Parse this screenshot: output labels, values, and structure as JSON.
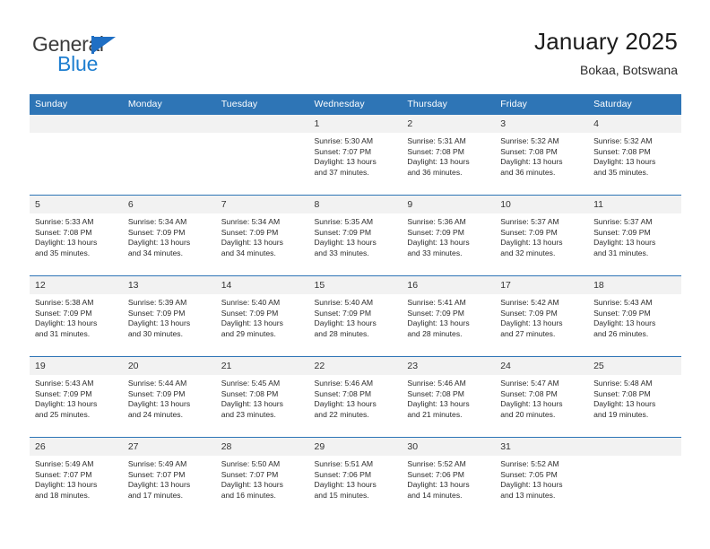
{
  "brand": {
    "name_part1": "General",
    "name_part2": "Blue",
    "flag_icon": "flag-triangle-icon",
    "accent_color": "#1f7fd0"
  },
  "header": {
    "title": "January 2025",
    "subtitle": "Bokaa, Botswana",
    "header_bg": "#2e75b6",
    "daynum_bg": "#f2f2f2"
  },
  "weekdays": [
    "Sunday",
    "Monday",
    "Tuesday",
    "Wednesday",
    "Thursday",
    "Friday",
    "Saturday"
  ],
  "weeks": [
    [
      {
        "day": "",
        "blank": true,
        "sunrise": "",
        "sunset": "",
        "daylight1": "",
        "daylight2": ""
      },
      {
        "day": "",
        "blank": true,
        "sunrise": "",
        "sunset": "",
        "daylight1": "",
        "daylight2": ""
      },
      {
        "day": "",
        "blank": true,
        "sunrise": "",
        "sunset": "",
        "daylight1": "",
        "daylight2": ""
      },
      {
        "day": "1",
        "blank": false,
        "sunrise": "Sunrise: 5:30 AM",
        "sunset": "Sunset: 7:07 PM",
        "daylight1": "Daylight: 13 hours",
        "daylight2": "and 37 minutes."
      },
      {
        "day": "2",
        "blank": false,
        "sunrise": "Sunrise: 5:31 AM",
        "sunset": "Sunset: 7:08 PM",
        "daylight1": "Daylight: 13 hours",
        "daylight2": "and 36 minutes."
      },
      {
        "day": "3",
        "blank": false,
        "sunrise": "Sunrise: 5:32 AM",
        "sunset": "Sunset: 7:08 PM",
        "daylight1": "Daylight: 13 hours",
        "daylight2": "and 36 minutes."
      },
      {
        "day": "4",
        "blank": false,
        "sunrise": "Sunrise: 5:32 AM",
        "sunset": "Sunset: 7:08 PM",
        "daylight1": "Daylight: 13 hours",
        "daylight2": "and 35 minutes."
      }
    ],
    [
      {
        "day": "5",
        "blank": false,
        "sunrise": "Sunrise: 5:33 AM",
        "sunset": "Sunset: 7:08 PM",
        "daylight1": "Daylight: 13 hours",
        "daylight2": "and 35 minutes."
      },
      {
        "day": "6",
        "blank": false,
        "sunrise": "Sunrise: 5:34 AM",
        "sunset": "Sunset: 7:09 PM",
        "daylight1": "Daylight: 13 hours",
        "daylight2": "and 34 minutes."
      },
      {
        "day": "7",
        "blank": false,
        "sunrise": "Sunrise: 5:34 AM",
        "sunset": "Sunset: 7:09 PM",
        "daylight1": "Daylight: 13 hours",
        "daylight2": "and 34 minutes."
      },
      {
        "day": "8",
        "blank": false,
        "sunrise": "Sunrise: 5:35 AM",
        "sunset": "Sunset: 7:09 PM",
        "daylight1": "Daylight: 13 hours",
        "daylight2": "and 33 minutes."
      },
      {
        "day": "9",
        "blank": false,
        "sunrise": "Sunrise: 5:36 AM",
        "sunset": "Sunset: 7:09 PM",
        "daylight1": "Daylight: 13 hours",
        "daylight2": "and 33 minutes."
      },
      {
        "day": "10",
        "blank": false,
        "sunrise": "Sunrise: 5:37 AM",
        "sunset": "Sunset: 7:09 PM",
        "daylight1": "Daylight: 13 hours",
        "daylight2": "and 32 minutes."
      },
      {
        "day": "11",
        "blank": false,
        "sunrise": "Sunrise: 5:37 AM",
        "sunset": "Sunset: 7:09 PM",
        "daylight1": "Daylight: 13 hours",
        "daylight2": "and 31 minutes."
      }
    ],
    [
      {
        "day": "12",
        "blank": false,
        "sunrise": "Sunrise: 5:38 AM",
        "sunset": "Sunset: 7:09 PM",
        "daylight1": "Daylight: 13 hours",
        "daylight2": "and 31 minutes."
      },
      {
        "day": "13",
        "blank": false,
        "sunrise": "Sunrise: 5:39 AM",
        "sunset": "Sunset: 7:09 PM",
        "daylight1": "Daylight: 13 hours",
        "daylight2": "and 30 minutes."
      },
      {
        "day": "14",
        "blank": false,
        "sunrise": "Sunrise: 5:40 AM",
        "sunset": "Sunset: 7:09 PM",
        "daylight1": "Daylight: 13 hours",
        "daylight2": "and 29 minutes."
      },
      {
        "day": "15",
        "blank": false,
        "sunrise": "Sunrise: 5:40 AM",
        "sunset": "Sunset: 7:09 PM",
        "daylight1": "Daylight: 13 hours",
        "daylight2": "and 28 minutes."
      },
      {
        "day": "16",
        "blank": false,
        "sunrise": "Sunrise: 5:41 AM",
        "sunset": "Sunset: 7:09 PM",
        "daylight1": "Daylight: 13 hours",
        "daylight2": "and 28 minutes."
      },
      {
        "day": "17",
        "blank": false,
        "sunrise": "Sunrise: 5:42 AM",
        "sunset": "Sunset: 7:09 PM",
        "daylight1": "Daylight: 13 hours",
        "daylight2": "and 27 minutes."
      },
      {
        "day": "18",
        "blank": false,
        "sunrise": "Sunrise: 5:43 AM",
        "sunset": "Sunset: 7:09 PM",
        "daylight1": "Daylight: 13 hours",
        "daylight2": "and 26 minutes."
      }
    ],
    [
      {
        "day": "19",
        "blank": false,
        "sunrise": "Sunrise: 5:43 AM",
        "sunset": "Sunset: 7:09 PM",
        "daylight1": "Daylight: 13 hours",
        "daylight2": "and 25 minutes."
      },
      {
        "day": "20",
        "blank": false,
        "sunrise": "Sunrise: 5:44 AM",
        "sunset": "Sunset: 7:09 PM",
        "daylight1": "Daylight: 13 hours",
        "daylight2": "and 24 minutes."
      },
      {
        "day": "21",
        "blank": false,
        "sunrise": "Sunrise: 5:45 AM",
        "sunset": "Sunset: 7:08 PM",
        "daylight1": "Daylight: 13 hours",
        "daylight2": "and 23 minutes."
      },
      {
        "day": "22",
        "blank": false,
        "sunrise": "Sunrise: 5:46 AM",
        "sunset": "Sunset: 7:08 PM",
        "daylight1": "Daylight: 13 hours",
        "daylight2": "and 22 minutes."
      },
      {
        "day": "23",
        "blank": false,
        "sunrise": "Sunrise: 5:46 AM",
        "sunset": "Sunset: 7:08 PM",
        "daylight1": "Daylight: 13 hours",
        "daylight2": "and 21 minutes."
      },
      {
        "day": "24",
        "blank": false,
        "sunrise": "Sunrise: 5:47 AM",
        "sunset": "Sunset: 7:08 PM",
        "daylight1": "Daylight: 13 hours",
        "daylight2": "and 20 minutes."
      },
      {
        "day": "25",
        "blank": false,
        "sunrise": "Sunrise: 5:48 AM",
        "sunset": "Sunset: 7:08 PM",
        "daylight1": "Daylight: 13 hours",
        "daylight2": "and 19 minutes."
      }
    ],
    [
      {
        "day": "26",
        "blank": false,
        "sunrise": "Sunrise: 5:49 AM",
        "sunset": "Sunset: 7:07 PM",
        "daylight1": "Daylight: 13 hours",
        "daylight2": "and 18 minutes."
      },
      {
        "day": "27",
        "blank": false,
        "sunrise": "Sunrise: 5:49 AM",
        "sunset": "Sunset: 7:07 PM",
        "daylight1": "Daylight: 13 hours",
        "daylight2": "and 17 minutes."
      },
      {
        "day": "28",
        "blank": false,
        "sunrise": "Sunrise: 5:50 AM",
        "sunset": "Sunset: 7:07 PM",
        "daylight1": "Daylight: 13 hours",
        "daylight2": "and 16 minutes."
      },
      {
        "day": "29",
        "blank": false,
        "sunrise": "Sunrise: 5:51 AM",
        "sunset": "Sunset: 7:06 PM",
        "daylight1": "Daylight: 13 hours",
        "daylight2": "and 15 minutes."
      },
      {
        "day": "30",
        "blank": false,
        "sunrise": "Sunrise: 5:52 AM",
        "sunset": "Sunset: 7:06 PM",
        "daylight1": "Daylight: 13 hours",
        "daylight2": "and 14 minutes."
      },
      {
        "day": "31",
        "blank": false,
        "sunrise": "Sunrise: 5:52 AM",
        "sunset": "Sunset: 7:05 PM",
        "daylight1": "Daylight: 13 hours",
        "daylight2": "and 13 minutes."
      },
      {
        "day": "",
        "blank": true,
        "sunrise": "",
        "sunset": "",
        "daylight1": "",
        "daylight2": ""
      }
    ]
  ]
}
